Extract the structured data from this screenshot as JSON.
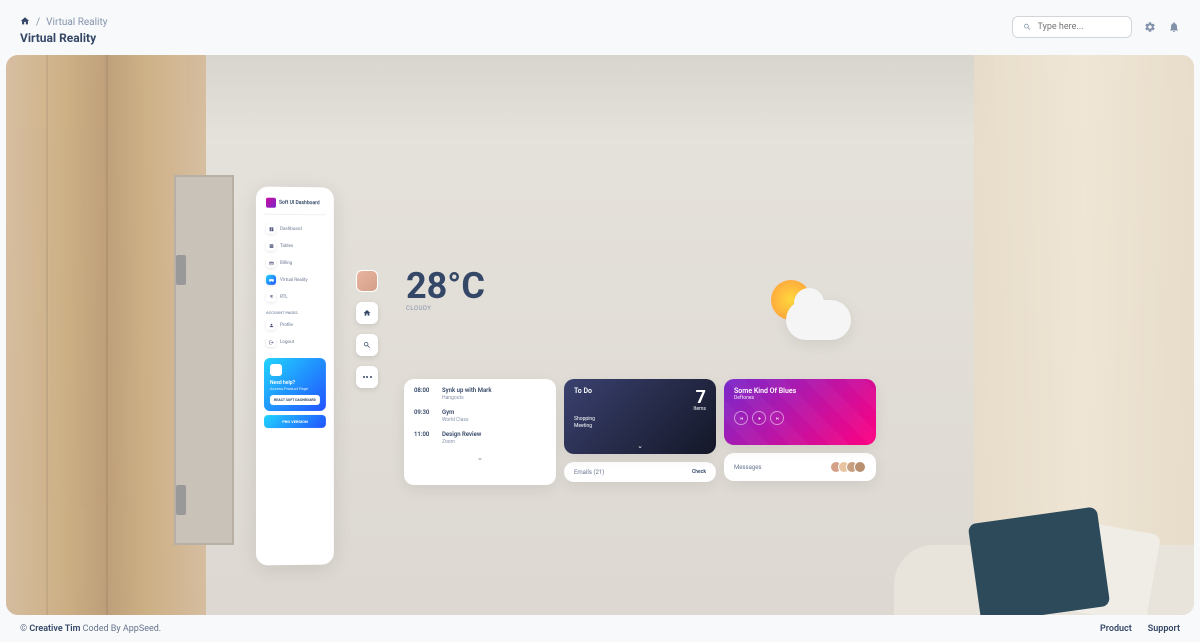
{
  "breadcrumb": {
    "current": "Virtual Reality"
  },
  "page_title": "Virtual Reality",
  "search": {
    "placeholder": "Type here..."
  },
  "sidebar": {
    "brand": "Soft UI Dashboard",
    "items": [
      {
        "label": "Dashboard"
      },
      {
        "label": "Tables"
      },
      {
        "label": "Billing"
      },
      {
        "label": "Virtual Reality"
      },
      {
        "label": "RTL"
      }
    ],
    "section_label": "Account Pages",
    "account_items": [
      {
        "label": "Profile"
      },
      {
        "label": "Logout"
      }
    ],
    "help": {
      "title": "Need help?",
      "subtitle": "Access Product Page",
      "button": "React Soft Dashboard"
    },
    "pro_button": "Pro Version"
  },
  "weather": {
    "temperature": "28°C",
    "condition": "Cloudy"
  },
  "schedule": [
    {
      "time": "08:00",
      "title": "Synk up with Mark",
      "sub": "Hangouts"
    },
    {
      "time": "09:30",
      "title": "Gym",
      "sub": "World Class"
    },
    {
      "time": "11:00",
      "title": "Design Review",
      "sub": "Zoom"
    }
  ],
  "todo": {
    "title": "To Do",
    "count": "7",
    "count_label": "Items",
    "items": [
      "Shopping",
      "Meeting"
    ]
  },
  "emails": {
    "label": "Emails (21)",
    "action": "Check"
  },
  "music": {
    "title": "Some Kind Of Blues",
    "artist": "Deftones"
  },
  "messages": {
    "label": "Messages"
  },
  "footer": {
    "copyright_prefix": "© ",
    "link1": "Creative Tim",
    "copyright_suffix": " Coded By AppSeed.",
    "product": "Product",
    "support": "Support"
  }
}
